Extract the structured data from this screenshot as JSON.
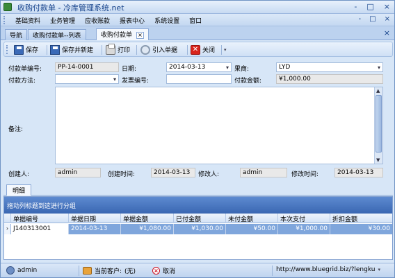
{
  "window": {
    "title": "收购付款单 - 冷库管理系统.net",
    "controls": [
      "-",
      "□",
      "×"
    ]
  },
  "menu": {
    "items": [
      "基础资料",
      "业务管理",
      "应收账款",
      "报表中心",
      "系统设置",
      "窗口"
    ],
    "mdi_controls": [
      "-",
      "□",
      "×"
    ]
  },
  "tabs": {
    "items": [
      "导航",
      "收购付款单--列表",
      "收购付款单"
    ],
    "close_glyph": "×",
    "strip_close": "×"
  },
  "toolbar": {
    "save": "保存",
    "save_new": "保存并新建",
    "print": "打印",
    "import": "引入单据",
    "close": "关闭",
    "close_glyph": "✕",
    "dropdown_glyph": "▾"
  },
  "form": {
    "payment_no": {
      "label": "付款单编号:",
      "value": "PP-14-0001"
    },
    "date": {
      "label": "日期:",
      "value": "2014-03-13"
    },
    "vendor": {
      "label": "果商:",
      "value": "LYD"
    },
    "payment_method": {
      "label": "付款方法:",
      "value": ""
    },
    "invoice_no": {
      "label": "发票编号:",
      "value": ""
    },
    "amount": {
      "label": "付款金额:",
      "value": "¥1,000.00"
    },
    "remark": {
      "label": "备注:",
      "value": ""
    },
    "creator": {
      "label": "创建人:",
      "value": "admin"
    },
    "created_time": {
      "label": "创建时间:",
      "value": "2014-03-13"
    },
    "modifier": {
      "label": "修改人:",
      "value": "admin"
    },
    "modified_time": {
      "label": "修改时间:",
      "value": "2014-03-13"
    }
  },
  "detail": {
    "tab_label": "明细",
    "group_hint": "拖动列标题到这进行分组",
    "columns": [
      "单据编号",
      "单据日期",
      "单据金额",
      "已付金额",
      "未付金额",
      "本次支付",
      "折扣金额"
    ],
    "rows": [
      {
        "indicator": "›",
        "cells": [
          "J140313001",
          "2014-03-13",
          "¥1,080.00",
          "¥1,030.00",
          "¥50.00",
          "¥1,000.00",
          "¥30.00"
        ]
      }
    ]
  },
  "status": {
    "user": "admin",
    "customer_label": "当前客户:",
    "customer_value": "(无)",
    "cancel": "取消",
    "url": "http://www.bluegrid.biz/?lengku",
    "url_arrow": "▾"
  },
  "colors": {
    "accent": "#15428b",
    "group_panel": "#4a76c2",
    "selected_cell": "#7fa6dc"
  }
}
